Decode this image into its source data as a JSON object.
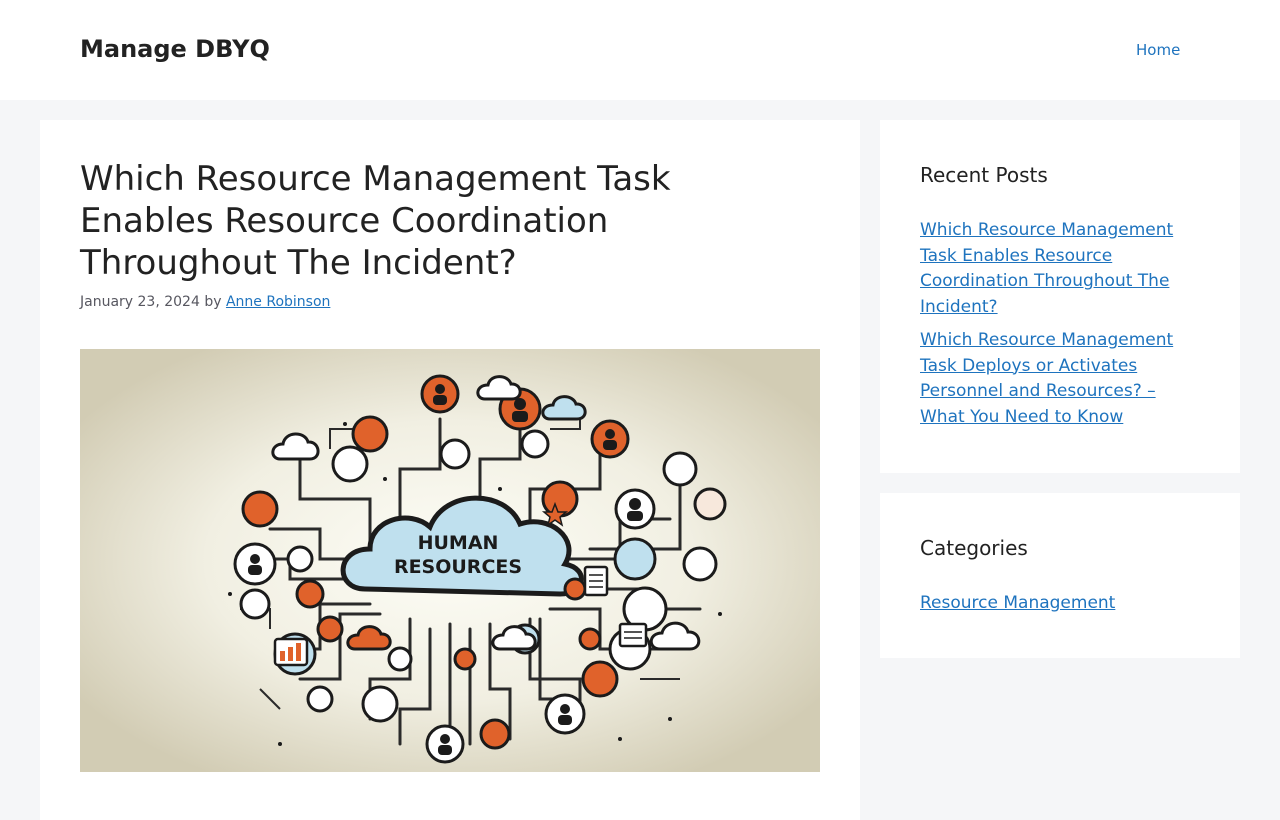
{
  "header": {
    "site_title": "Manage DBYQ",
    "nav": {
      "home_label": "Home"
    }
  },
  "post": {
    "title": "Which Resource Management Task Enables Resource Coordination Throughout The Incident?",
    "date": "January 23, 2024",
    "by_label": "by",
    "author": "Anne Robinson",
    "image": {
      "center_text_line1": "HUMAN",
      "center_text_line2": "RESOURCES",
      "background_color": "#ddd8c4",
      "accent_color": "#e0622b",
      "cloud_color": "#bfe0ee"
    }
  },
  "sidebar": {
    "recent_posts": {
      "title": "Recent Posts",
      "items": [
        {
          "label": "Which Resource Management Task Enables Resource Coordination Throughout The Incident?"
        },
        {
          "label": "Which Resource Management Task Deploys or Activates Personnel and Resources? – What You Need to Know"
        }
      ]
    },
    "categories": {
      "title": "Categories",
      "items": [
        {
          "label": "Resource Management"
        }
      ]
    }
  },
  "colors": {
    "link": "#1e73be",
    "page_bg": "#f5f6f8"
  }
}
